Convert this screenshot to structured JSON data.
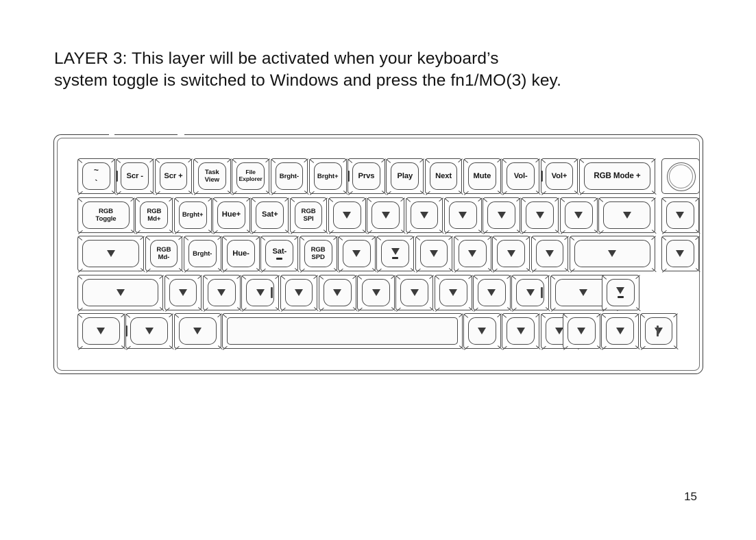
{
  "page": {
    "heading": "LAYER 3: This layer will be activated when your keyboard’s\nsystem toggle is switched to Windows and press the fn1/MO(3) key.",
    "page_number": "15"
  },
  "keyboard": {
    "name": "layer-3-keymap",
    "knob_label": "rotary-encoder-knob",
    "blank_glyph": "▽",
    "rows": [
      {
        "name": "row-function",
        "keys": [
          {
            "label": "~\n`",
            "style": "tilde",
            "w": 1
          },
          {
            "label": "Scr -",
            "w": 1
          },
          {
            "label": "Scr +",
            "w": 1
          },
          {
            "label": "Task\nView",
            "w": 1,
            "size": "sm"
          },
          {
            "label": "File\nExplorer",
            "w": 1,
            "size": "xs"
          },
          {
            "label": "Brght-",
            "w": 1,
            "size": "sm"
          },
          {
            "label": "Brght+",
            "w": 1,
            "size": "sm"
          },
          {
            "label": "Prvs",
            "w": 1
          },
          {
            "label": "Play",
            "w": 1
          },
          {
            "label": "Next",
            "w": 1
          },
          {
            "label": "Mute",
            "w": 1
          },
          {
            "label": "Vol-",
            "w": 1
          },
          {
            "label": "Vol+",
            "w": 1
          },
          {
            "label": "RGB Mode +",
            "w": 2,
            "size": "wide"
          }
        ],
        "side_key": {
          "type": "knob"
        }
      },
      {
        "name": "row-number",
        "keys": [
          {
            "label": "RGB\nToggle",
            "w": 1.5,
            "size": "sm"
          },
          {
            "label": "RGB\nMd+",
            "w": 1,
            "size": "sm"
          },
          {
            "label": "Brght+",
            "w": 1,
            "size": "sm"
          },
          {
            "label": "Hue+",
            "w": 1
          },
          {
            "label": "Sat+",
            "w": 1
          },
          {
            "label": "RGB\nSPI",
            "w": 1,
            "size": "sm"
          },
          {
            "label": "",
            "w": 1
          },
          {
            "label": "",
            "w": 1
          },
          {
            "label": "",
            "w": 1
          },
          {
            "label": "",
            "w": 1
          },
          {
            "label": "",
            "w": 1
          },
          {
            "label": "",
            "w": 1
          },
          {
            "label": "",
            "w": 1
          },
          {
            "label": "",
            "w": 1.5
          }
        ],
        "side_key": {
          "label": "",
          "type": "blank"
        }
      },
      {
        "name": "row-home",
        "keys": [
          {
            "label": "",
            "w": 1.75
          },
          {
            "label": "RGB\nMd-",
            "w": 1,
            "size": "sm"
          },
          {
            "label": "Brght-",
            "w": 1,
            "size": "sm"
          },
          {
            "label": "Hue-",
            "w": 1
          },
          {
            "label": "Sat-",
            "w": 1,
            "homing": true
          },
          {
            "label": "RGB\nSPD",
            "w": 1,
            "size": "sm"
          },
          {
            "label": "",
            "w": 1
          },
          {
            "label": "",
            "w": 1,
            "homing": true
          },
          {
            "label": "",
            "w": 1
          },
          {
            "label": "",
            "w": 1
          },
          {
            "label": "",
            "w": 1
          },
          {
            "label": "",
            "w": 1
          },
          {
            "label": "",
            "w": 2.25
          }
        ],
        "side_key": {
          "label": "",
          "type": "blank"
        }
      },
      {
        "name": "row-bottom-alpha",
        "keys": [
          {
            "label": "",
            "w": 2.25
          },
          {
            "label": "",
            "w": 1
          },
          {
            "label": "",
            "w": 1
          },
          {
            "label": "",
            "w": 1
          },
          {
            "label": "",
            "w": 1
          },
          {
            "label": "",
            "w": 1
          },
          {
            "label": "",
            "w": 1
          },
          {
            "label": "",
            "w": 1
          },
          {
            "label": "",
            "w": 1
          },
          {
            "label": "",
            "w": 1
          },
          {
            "label": "",
            "w": 1
          },
          {
            "label": "",
            "w": 1.75
          }
        ],
        "arrow_up": {
          "label": "",
          "homing": true
        }
      },
      {
        "name": "row-modifier",
        "keys": [
          {
            "label": "",
            "w": 1.25
          },
          {
            "label": "",
            "w": 1.25
          },
          {
            "label": "",
            "w": 1.25
          },
          {
            "label": "",
            "w": 6.25,
            "space": true
          },
          {
            "label": "",
            "w": 1
          },
          {
            "label": "",
            "w": 1
          },
          {
            "label": "",
            "w": 1
          }
        ],
        "arrows": [
          {
            "label": "",
            "name": "arrow-left-key"
          },
          {
            "label": "",
            "name": "arrow-down-key"
          },
          {
            "label": "",
            "name": "arrow-right-key"
          }
        ]
      }
    ]
  }
}
